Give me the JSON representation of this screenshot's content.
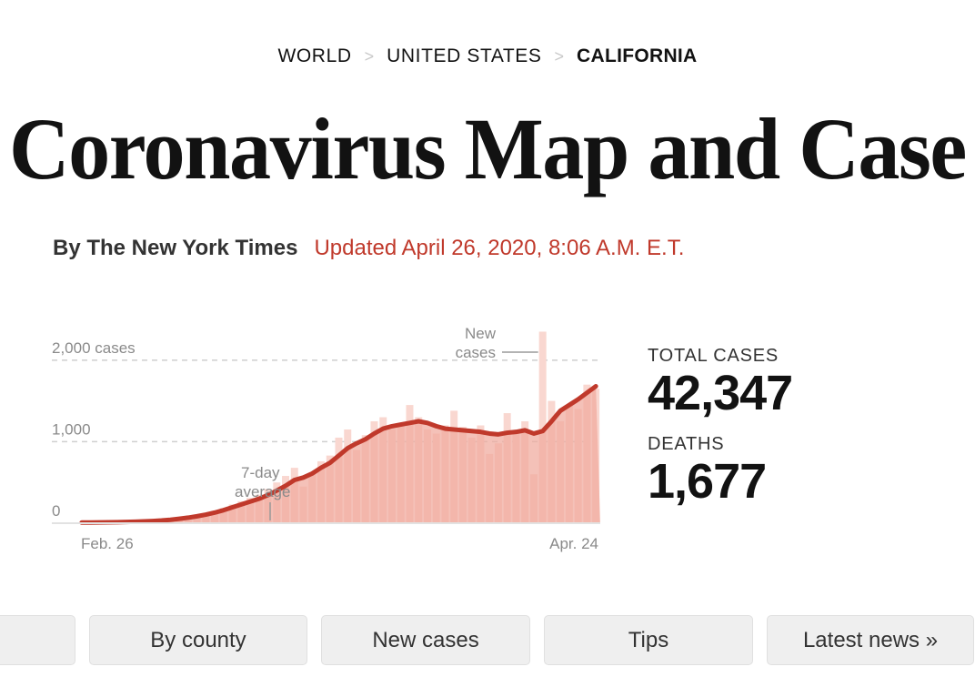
{
  "breadcrumb": {
    "items": [
      {
        "label": "WORLD",
        "current": false
      },
      {
        "label": "UNITED STATES",
        "current": false
      },
      {
        "label": "CALIFORNIA",
        "current": true
      }
    ],
    "separator": ">"
  },
  "headline": "Coronavirus Map and Case",
  "byline": {
    "author": "By The New York Times",
    "updated": "Updated April 26, 2020, 8:06 A.M. E.T."
  },
  "stats": [
    {
      "label": "TOTAL CASES",
      "value": "42,347"
    },
    {
      "label": "DEATHS",
      "value": "1,677"
    }
  ],
  "buttons": [
    {
      "label": "",
      "kind": "empty"
    },
    {
      "label": "By county",
      "kind": "w-bycounty"
    },
    {
      "label": "New cases",
      "kind": "w-newcases"
    },
    {
      "label": "Tips",
      "kind": "w-tips"
    },
    {
      "label": "Latest news »",
      "kind": "w-latest"
    }
  ],
  "colors": {
    "bar": "#f3b2a7",
    "bar_light": "#f9d7d0",
    "area": "#f0a99d",
    "line": "#c0392b",
    "accent_red": "#c0392b",
    "axis_text": "#8a8a8a",
    "gridline": "#cfcfcf",
    "button_bg": "#efefef",
    "text": "#121212"
  },
  "chart_data": {
    "type": "bar",
    "title": "",
    "xlabel": "",
    "ylabel": "cases",
    "ylim": [
      0,
      2400
    ],
    "grid": true,
    "y_ticks": [
      0,
      1000,
      2000
    ],
    "y_tick_labels": [
      "0",
      "1,000",
      "2,000 cases"
    ],
    "x_tick_labels": [
      "Feb. 26",
      "Apr. 24"
    ],
    "annotations": [
      {
        "text": "New cases",
        "target": "tall-bar-spike"
      },
      {
        "text": "7-day average",
        "target": "average-line"
      }
    ],
    "legend": [
      "New cases",
      "7-day average"
    ],
    "legend_position": "inline-annotation",
    "categories": [
      "Feb. 26",
      "Feb. 27",
      "Feb. 28",
      "Feb. 29",
      "Mar. 1",
      "Mar. 2",
      "Mar. 3",
      "Mar. 4",
      "Mar. 5",
      "Mar. 6",
      "Mar. 7",
      "Mar. 8",
      "Mar. 9",
      "Mar. 10",
      "Mar. 11",
      "Mar. 12",
      "Mar. 13",
      "Mar. 14",
      "Mar. 15",
      "Mar. 16",
      "Mar. 17",
      "Mar. 18",
      "Mar. 19",
      "Mar. 20",
      "Mar. 21",
      "Mar. 22",
      "Mar. 23",
      "Mar. 24",
      "Mar. 25",
      "Mar. 26",
      "Mar. 27",
      "Mar. 28",
      "Mar. 29",
      "Mar. 30",
      "Mar. 31",
      "Apr. 1",
      "Apr. 2",
      "Apr. 3",
      "Apr. 4",
      "Apr. 5",
      "Apr. 6",
      "Apr. 7",
      "Apr. 8",
      "Apr. 9",
      "Apr. 10",
      "Apr. 11",
      "Apr. 12",
      "Apr. 13",
      "Apr. 14",
      "Apr. 15",
      "Apr. 16",
      "Apr. 17",
      "Apr. 18",
      "Apr. 19",
      "Apr. 20",
      "Apr. 21",
      "Apr. 22",
      "Apr. 23",
      "Apr. 24"
    ],
    "series": [
      {
        "name": "New cases",
        "type": "bar",
        "values": [
          5,
          6,
          8,
          10,
          12,
          14,
          18,
          22,
          28,
          35,
          45,
          60,
          75,
          95,
          120,
          150,
          185,
          230,
          270,
          310,
          350,
          420,
          500,
          580,
          680,
          450,
          620,
          760,
          830,
          1050,
          1150,
          900,
          1080,
          1250,
          1300,
          1150,
          1200,
          1450,
          1300,
          1150,
          1100,
          1200,
          1380,
          1180,
          1050,
          1200,
          850,
          980,
          1350,
          1100,
          1250,
          600,
          2350,
          1500,
          1250,
          1450,
          1400,
          1700,
          1650
        ]
      },
      {
        "name": "7-day average",
        "type": "line",
        "values": [
          8,
          9,
          10,
          11,
          13,
          15,
          18,
          22,
          27,
          33,
          42,
          54,
          68,
          85,
          105,
          130,
          160,
          195,
          230,
          265,
          300,
          345,
          400,
          460,
          530,
          560,
          610,
          680,
          740,
          830,
          920,
          980,
          1030,
          1100,
          1160,
          1190,
          1210,
          1230,
          1250,
          1230,
          1190,
          1160,
          1150,
          1140,
          1130,
          1120,
          1100,
          1090,
          1110,
          1120,
          1140,
          1100,
          1130,
          1250,
          1380,
          1450,
          1520,
          1600,
          1680
        ]
      }
    ]
  }
}
